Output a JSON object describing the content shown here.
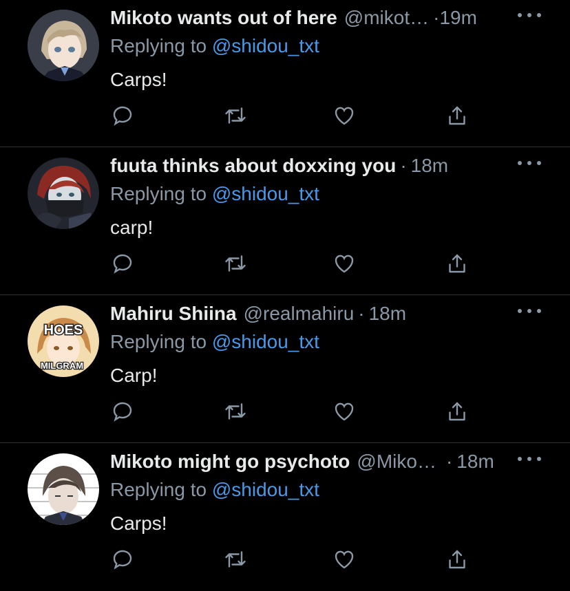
{
  "colors": {
    "background": "#000000",
    "name": "#e7e9ea",
    "muted": "#8b98a5",
    "link": "#4a99e9",
    "divider": "#2f3336"
  },
  "icons": [
    "reply-icon",
    "retweet-icon",
    "like-icon",
    "share-icon",
    "more-icon"
  ],
  "tweets": [
    {
      "name": "Mikoto wants out of here",
      "handle": "@mikot…",
      "dot": "·",
      "time": "19m",
      "reply_prefix": "Replying to ",
      "mention": "@shidou_txt",
      "text": "Carps!"
    },
    {
      "name": "fuuta thinks about doxxing you",
      "handle": "",
      "dot": "·",
      "time": "18m",
      "reply_prefix": "Replying to ",
      "mention": "@shidou_txt",
      "text": "carp!"
    },
    {
      "name": "Mahiru Shiina",
      "handle": "@realmahiru",
      "dot": "·",
      "time": "18m",
      "reply_prefix": "Replying to ",
      "mention": "@shidou_txt",
      "text": "Carp!",
      "avatar_text": {
        "top": "HOES",
        "bottom": "MILGRAM"
      }
    },
    {
      "name": "Mikoto might go psychoto",
      "handle": "@Miko…",
      "dot": "·",
      "time": "18m",
      "reply_prefix": "Replying to ",
      "mention": "@shidou_txt",
      "text": "Carps!"
    }
  ]
}
